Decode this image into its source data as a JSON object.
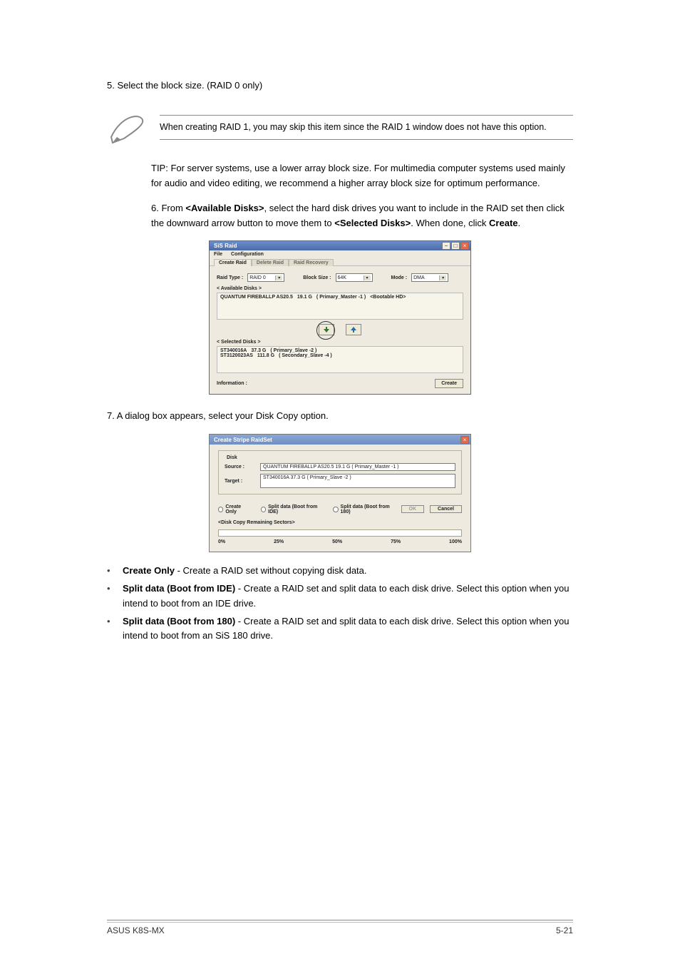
{
  "page": {
    "lead": "5. Select the block size. (RAID 0 only)",
    "note": "When creating RAID 1, you may skip this item since the RAID 1 window does not have this option.",
    "para_tip": "TIP: For server systems, use a lower array block size. For multimedia computer systems used mainly for audio and video editing, we recommend a higher array block size for optimum performance.",
    "para_step6a": "6. From ",
    "para_step6b": ", select the hard disk drives you want to include in the RAID set then click the downward arrow button to move them to ",
    "para_step6c": ". When done, click ",
    "para_step6d": ".",
    "avail_bold": "<Available Disks>",
    "sel_bold": "<Selected Disks>",
    "create_bold": "Create",
    "para_step7": "7. A dialog box appears, select your Disk Copy option.",
    "li1_bold": "Create Only",
    "li1_txt": " - Create a RAID set without copying disk data.",
    "li2_bold": "Split data (Boot from IDE)",
    "li2_txt": " - Create a RAID set and split data to each disk drive. Select this option when you intend to boot from an IDE drive.",
    "li3_bold": "Split data (Boot from 180)",
    "li3_txt": " - Create a RAID set and split data to each disk drive. Select this option when you intend to boot from an SiS 180 drive."
  },
  "shot1": {
    "title": "SiS Raid",
    "menu": {
      "file": "File",
      "config": "Configuration"
    },
    "tabs": {
      "t1": "Create Raid",
      "t2": "Delete Raid",
      "t3": "Raid Recovery"
    },
    "row": {
      "raidtype_lbl": "Raid Type :",
      "raidtype_val": "RAID 0",
      "blocksize_lbl": "Block Size :",
      "blocksize_val": "64K",
      "mode_lbl": "Mode :",
      "mode_val": "DMA"
    },
    "avail_hdr": "< Available Disks >",
    "avail_rows": [
      {
        "model": "QUANTUM FIREBALLP AS20.5",
        "size": "19.1 G",
        "loc": "( Primary_Master -1 )",
        "tag": "<Bootable HD>"
      }
    ],
    "sel_hdr": "< Selected Disks >",
    "sel_rows": [
      {
        "model": "ST340016A",
        "size": "37.3 G",
        "loc": "( Primary_Slave -2 )"
      },
      {
        "model": "ST3120023AS",
        "size": "111.8 G",
        "loc": "( Secondary_Slave -4 )"
      }
    ],
    "info_lbl": "Information :",
    "create_btn": "Create"
  },
  "shot2": {
    "title": "Create Stripe RaidSet",
    "group": "Disk",
    "source_lbl": "Source :",
    "source_val": "QUANTUM FIREBALLP AS20.5     19.1 G  ( Primary_Master -1 )",
    "target_lbl": "Target :",
    "target_val": "ST340016A     37.3 G  ( Primary_Slave -2 )",
    "r1": "Create Only",
    "r2": "Split data (Boot from IDE)",
    "r3": "Split data (Boot from 180)",
    "ok": "OK",
    "cancel": "Cancel",
    "note": "<Disk Copy Remaining Sectors>",
    "p0": "0%",
    "p25": "25%",
    "p50": "50%",
    "p75": "75%",
    "p100": "100%"
  },
  "footer": {
    "left": "ASUS K8S-MX",
    "right": "5-21"
  }
}
